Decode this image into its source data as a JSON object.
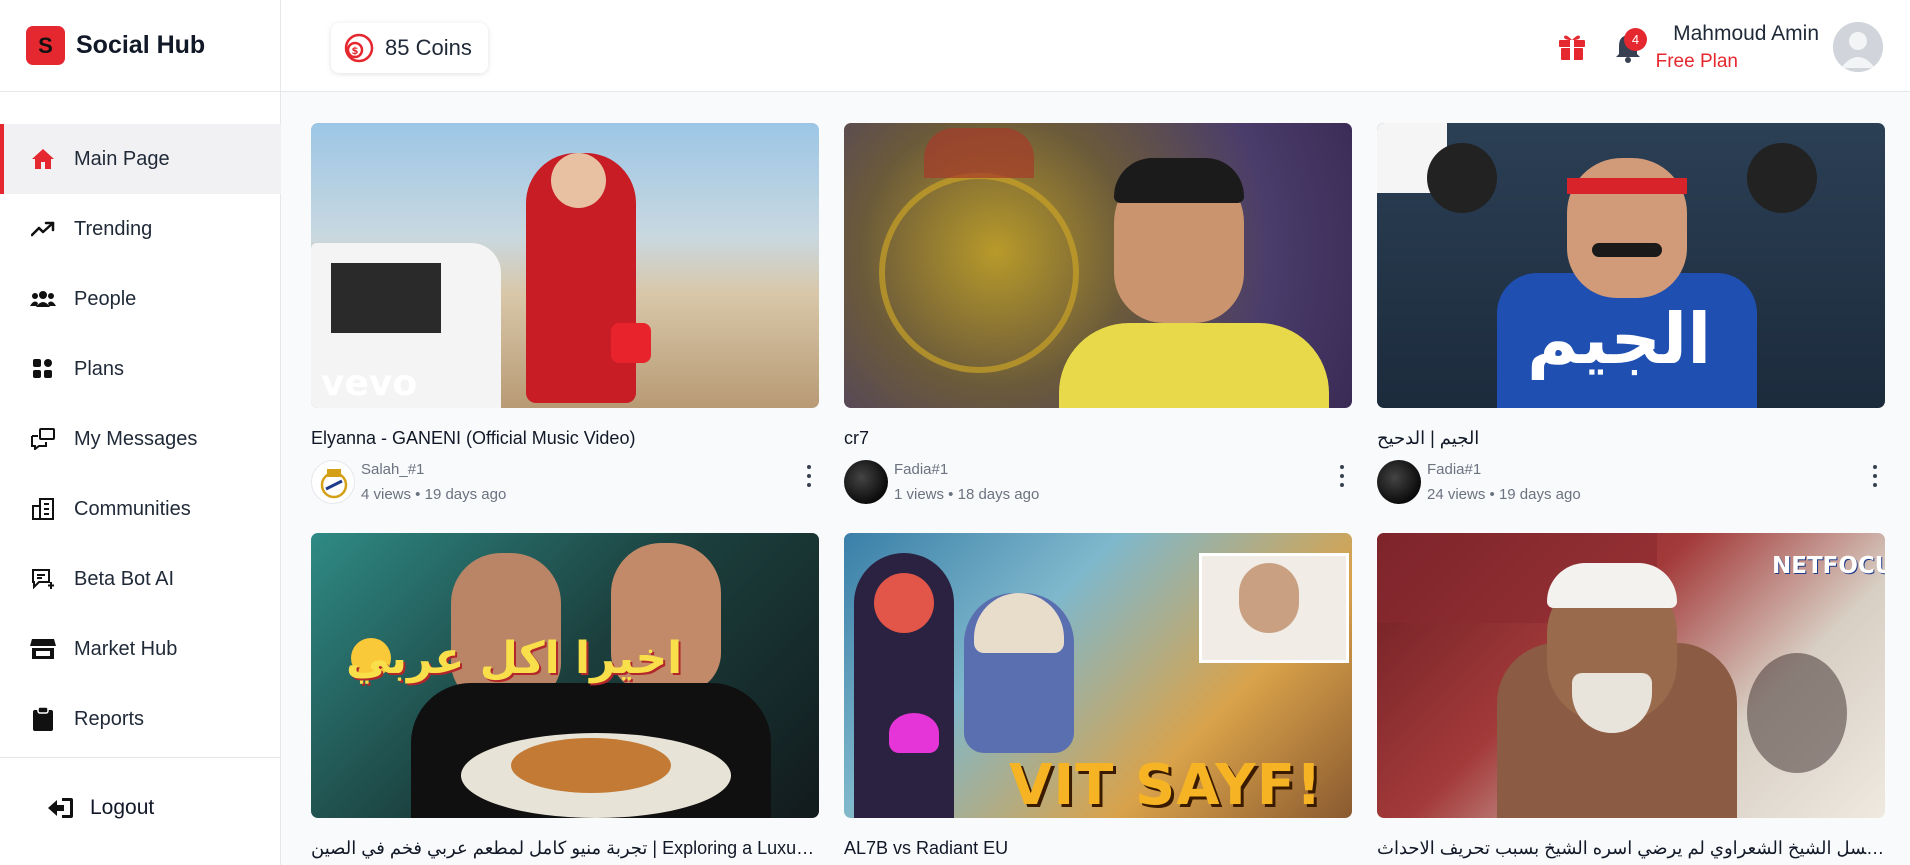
{
  "app": {
    "logo_letter": "S",
    "name": "Social Hub"
  },
  "header": {
    "coins_label": "85 Coins",
    "notification_count": "4",
    "user_name": "Mahmoud Amin",
    "user_plan": "Free Plan"
  },
  "sidebar": {
    "items": [
      {
        "label": "Main Page",
        "icon": "home-icon"
      },
      {
        "label": "Trending",
        "icon": "trending-icon"
      },
      {
        "label": "People",
        "icon": "people-icon"
      },
      {
        "label": "Plans",
        "icon": "plans-icon"
      },
      {
        "label": "My Messages",
        "icon": "messages-icon"
      },
      {
        "label": "Communities",
        "icon": "communities-icon"
      },
      {
        "label": "Beta Bot AI",
        "icon": "bot-icon"
      },
      {
        "label": "Market Hub",
        "icon": "store-icon"
      },
      {
        "label": "Reports",
        "icon": "clipboard-icon"
      }
    ],
    "logout_label": "Logout"
  },
  "videos": [
    {
      "title": "Elyanna - GANENI (Official Music Video)",
      "channel": "Salah_#1",
      "stats": "4 views • 19 days ago",
      "thumb_text": "vevo"
    },
    {
      "title": "cr7",
      "channel": "Fadia#1",
      "stats": "1 views • 18 days ago",
      "thumb_text": ""
    },
    {
      "title": "الجيم | الدحيح",
      "channel": "Fadia#1",
      "stats": "24 views • 19 days ago",
      "thumb_text": "الجيم"
    },
    {
      "title": "تجربة منيو كامل لمطعم عربي فخم في الصين | Exploring a Luxurious",
      "channel": "",
      "stats": "",
      "thumb_text": "اخيرا اكل عربي"
    },
    {
      "title": "AL7B vs Radiant EU",
      "channel": "",
      "stats": "",
      "thumb_text": "VIT SAYF!"
    },
    {
      "title": "مسلسل الشيخ الشعراوي لم يرضي اسره الشيخ بسبب تحريف الاحداث",
      "channel": "",
      "stats": "",
      "thumb_text": "NETFOCUS"
    }
  ],
  "colors": {
    "accent": "#e5282f",
    "muted": "#6b7280"
  }
}
